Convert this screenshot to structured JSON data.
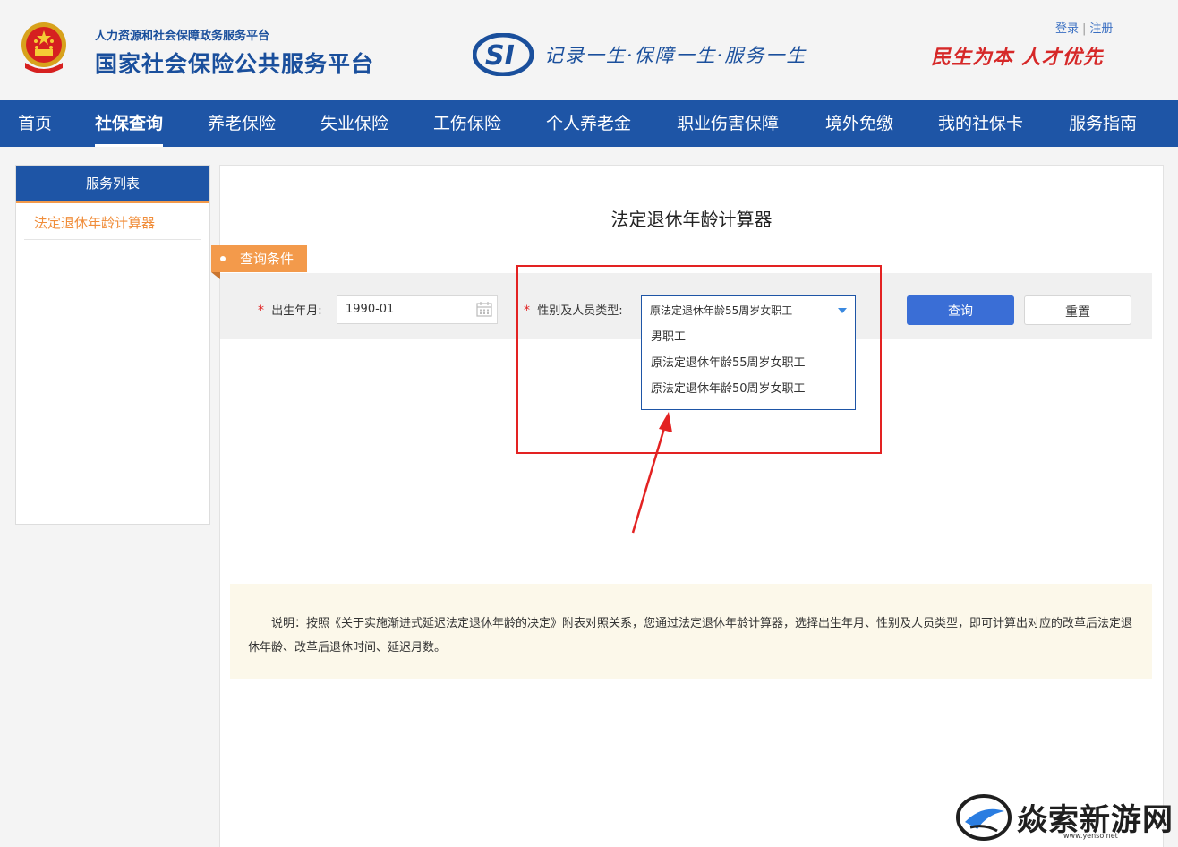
{
  "header": {
    "platform_sub": "人力资源和社会保障政务服务平台",
    "platform_main": "国家社会保险公共服务平台",
    "slogan": "记录一生·保障一生·服务一生",
    "motto": "民生为本 人才优先",
    "login": "登录",
    "register": "注册",
    "separator": "|"
  },
  "nav": {
    "items": [
      "首页",
      "社保查询",
      "养老保险",
      "失业保险",
      "工伤保险",
      "个人养老金",
      "职业伤害保障",
      "境外免缴",
      "我的社保卡",
      "服务指南"
    ],
    "active": "社保查询"
  },
  "sidebar": {
    "title": "服务列表",
    "items": [
      "法定退休年龄计算器"
    ]
  },
  "main": {
    "title": "法定退休年龄计算器",
    "condition_tag": "查询条件",
    "required_mark": "*",
    "birth_label": "出生年月:",
    "birth_value": "1990-01",
    "type_label": "性别及人员类型:",
    "type_selected": "原法定退休年龄55周岁女职工",
    "type_options": [
      "男职工",
      "原法定退休年龄55周岁女职工",
      "原法定退休年龄50周岁女职工"
    ],
    "query_button": "查询",
    "reset_button": "重置",
    "note": "说明：按照《关于实施渐进式延迟法定退休年龄的决定》附表对照关系，您通过法定退休年龄计算器，选择出生年月、性别及人员类型，即可计算出对应的改革后法定退休年龄、改革后退休时间、延迟月数。"
  },
  "watermark": {
    "text": "焱索新游网",
    "url": "www.yenso.net"
  },
  "colors": {
    "brand_blue": "#1e55a6",
    "accent_orange": "#f39a4b",
    "query_blue": "#3a6ed6",
    "highlight_red": "#e32222"
  }
}
